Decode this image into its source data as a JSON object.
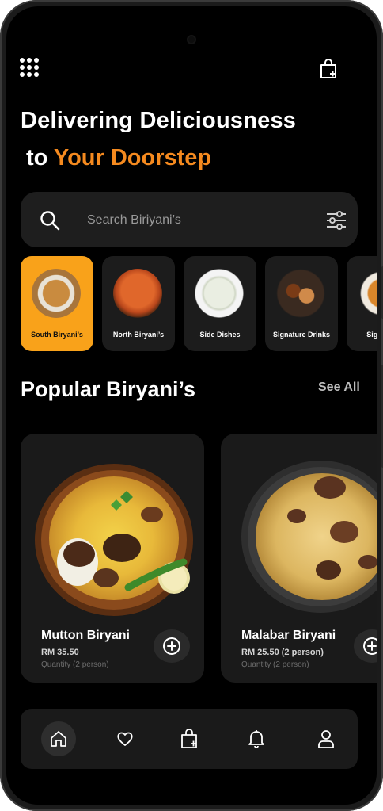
{
  "header": {
    "menu_icon": "grid-menu-icon",
    "cart_icon": "shopping-bag-icon",
    "title_line1": "Delivering Deliciousness",
    "title_line2_prefix": "to ",
    "title_line2_accent": "Your Doorstep"
  },
  "search": {
    "placeholder": "Search Biriyani’s",
    "icon": "search-icon",
    "filter_icon": "filter-sliders-icon"
  },
  "categories": [
    {
      "label": "South Biryani’s",
      "active": true
    },
    {
      "label": "North Biryani’s",
      "active": false
    },
    {
      "label": "Side Dishes",
      "active": false
    },
    {
      "label": "Signature Drinks",
      "active": false
    },
    {
      "label": "Signature",
      "active": false
    }
  ],
  "popular": {
    "title": "Popular Biryani’s",
    "see_all": "See All",
    "items": [
      {
        "name": "Mutton Biryani",
        "price": "RM 35.50",
        "quantity": "Quantity (2 person)",
        "add_icon": "add-circle-icon"
      },
      {
        "name": "Malabar Biryani",
        "price": "RM 25.50 (2 person)",
        "quantity": "Quantity (2 person)",
        "add_icon": "add-circle-icon"
      }
    ]
  },
  "bottom_nav": [
    {
      "icon": "home-icon",
      "active": true
    },
    {
      "icon": "heart-icon",
      "active": false
    },
    {
      "icon": "shopping-bag-icon",
      "active": false
    },
    {
      "icon": "bell-icon",
      "active": false
    },
    {
      "icon": "user-icon",
      "active": false
    }
  ],
  "colors": {
    "accent": "#F58A1F",
    "active_category": "#F9A21A",
    "background": "#000000",
    "card": "#1a1a1a"
  }
}
